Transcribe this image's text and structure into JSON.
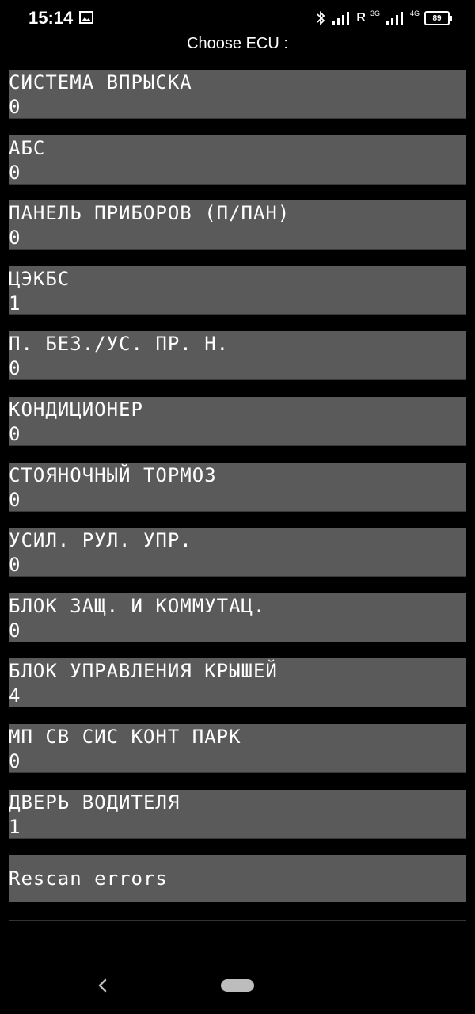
{
  "status_bar": {
    "time": "15:14",
    "roaming_label": "R",
    "network_type_1": "3G",
    "network_type_2": "4G",
    "battery_level": "89"
  },
  "title": "Choose ECU :",
  "ecu_items": [
    {
      "name": "СИСТЕМА ВПРЫСКА",
      "count": "0"
    },
    {
      "name": "АБС",
      "count": "0"
    },
    {
      "name": "ПАНЕЛЬ ПРИБОРОВ (П/ПАН)",
      "count": "0"
    },
    {
      "name": "ЦЭКБС",
      "count": "1"
    },
    {
      "name": "П. БЕЗ./УС. ПР. Н.",
      "count": "0"
    },
    {
      "name": "КОНДИЦИОНЕР",
      "count": "0"
    },
    {
      "name": "СТОЯНОЧНЫЙ ТОРМОЗ",
      "count": "0"
    },
    {
      "name": "УСИЛ. РУЛ. УПР.",
      "count": "0"
    },
    {
      "name": "БЛОК ЗАЩ. И КОММУТАЦ.",
      "count": "0"
    },
    {
      "name": "БЛОК УПРАВЛЕНИЯ КРЫШЕЙ",
      "count": "4"
    },
    {
      "name": "МП СВ СИС КОНТ ПАРК",
      "count": "0"
    },
    {
      "name": "ДВЕРЬ ВОДИТЕЛЯ",
      "count": "1"
    }
  ],
  "rescan_label": "Rescan errors",
  "icons": {
    "gallery": "gallery-icon",
    "bluetooth": "bluetooth-icon",
    "signal": "signal-icon",
    "battery": "battery-icon",
    "back": "back-icon",
    "home": "home-pill"
  },
  "colors": {
    "background": "#000000",
    "item_background": "#5a5a5a",
    "text": "#ffffff"
  }
}
